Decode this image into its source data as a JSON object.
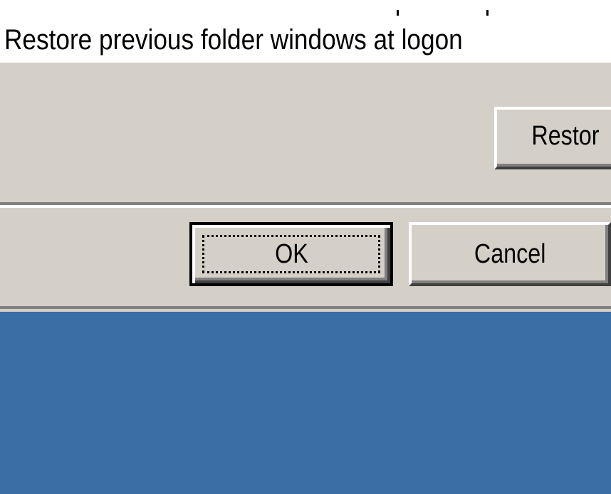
{
  "option_row": {
    "label": "Restore previous folder windows at logon"
  },
  "buttons": {
    "restore_label": "Restor",
    "ok_label": "OK",
    "cancel_label": "Cancel"
  },
  "colors": {
    "dialog_face": "#d4d0c8",
    "desktop": "#3a6ea5",
    "highlight": "#ffffff",
    "shadow": "#808080",
    "dark_shadow": "#404040"
  }
}
